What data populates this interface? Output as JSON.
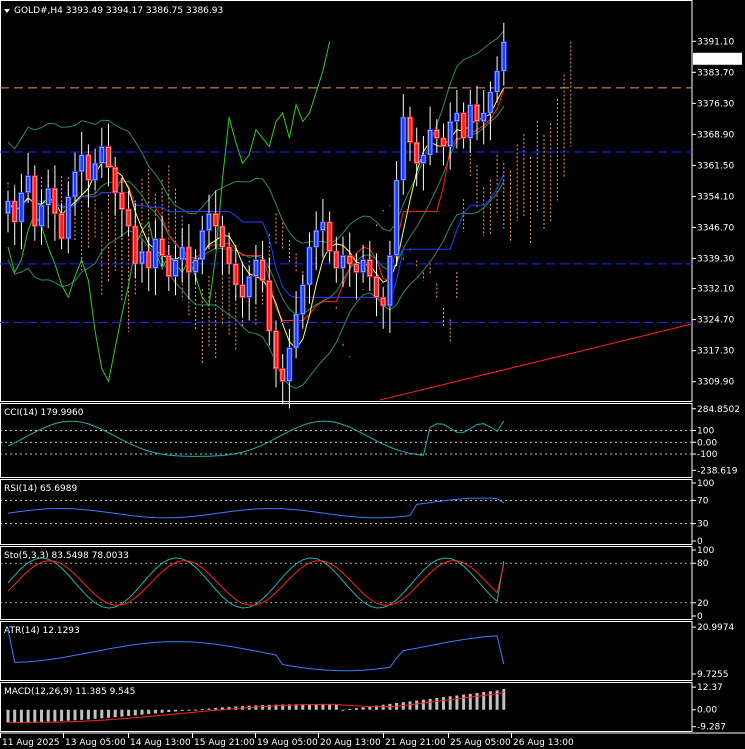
{
  "header": {
    "symbol_label": "GOLD#,H4",
    "ohlc_label": "3393.49 3394.17 3386.75 3386.93"
  },
  "colors": {
    "bg": "#000000",
    "up": "#1f3fff",
    "down": "#ff2020",
    "text": "#ffffff",
    "grid": "#ffffff",
    "panel_border": "#ffffff",
    "kumo": "#ff9966",
    "ichimoku_tenkan": "#ff2020",
    "ichimoku_kijun": "#1f3fff",
    "chikou": "#2ecc2e",
    "bollinger": "#2e8b57",
    "ma": "#ffff66",
    "hline_blue": "#2424ff",
    "hline_orange": "#d2a26b",
    "trend": "#ff2020",
    "cci": "#20b2aa",
    "rsi": "#3a7bff",
    "stoch_main": "#20b2aa",
    "stoch_signal": "#ff2020",
    "atr": "#3a7bff",
    "macd_signal": "#ff2020",
    "macd_hist": "#c0c0c0"
  },
  "chart_data": [
    {
      "type": "candlestick",
      "title": "GOLD#,H4",
      "ylim": [
        3306,
        3400
      ],
      "yticks": [
        "3391.10",
        "3383.70",
        "3376.30",
        "3368.90",
        "3361.50",
        "3354.10",
        "3346.70",
        "3339.30",
        "3332.10",
        "3324.70",
        "3317.30",
        "3309.90"
      ],
      "last_price_label": "3386.93",
      "x_tick_labels": [
        "11 Aug 2025",
        "13 Aug 05:00",
        "14 Aug 13:00",
        "15 Aug 21:00",
        "19 Aug 05:00",
        "20 Aug 13:00",
        "21 Aug 21:00",
        "25 Aug 05:00",
        "26 Aug 13:00"
      ],
      "horizontal_lines": [
        {
          "value": 3380.0,
          "style": "dashed",
          "color": "orange"
        },
        {
          "value": 3364.7,
          "style": "dashed",
          "color": "blue"
        },
        {
          "value": 3338.0,
          "style": "dashed",
          "color": "blue"
        },
        {
          "value": 3324.0,
          "style": "dashed",
          "color": "blue"
        }
      ],
      "close": [
        3353,
        3348,
        3355,
        3359,
        3347,
        3352,
        3356,
        3350,
        3344,
        3354,
        3360,
        3364,
        3358,
        3362,
        3366,
        3361,
        3355,
        3351,
        3347,
        3338,
        3341,
        3337,
        3344,
        3340,
        3335,
        3339,
        3342,
        3336,
        3339,
        3346,
        3350,
        3347,
        3342,
        3338,
        3333,
        3330,
        3335,
        3339,
        3334,
        3322,
        3313,
        3310,
        3318,
        3326,
        3333,
        3342,
        3346,
        3348,
        3341,
        3337,
        3340,
        3338,
        3336,
        3339,
        3335,
        3330,
        3328,
        3340,
        3358,
        3373,
        3367,
        3362,
        3364,
        3370,
        3368,
        3366,
        3372,
        3374,
        3368,
        3376,
        3372,
        3374,
        3379,
        3384,
        3391
      ]
    },
    {
      "type": "line",
      "title": "CCI(14) 179.9960",
      "ylim": [
        -270,
        300
      ],
      "yticks": [
        "284.8502",
        "100",
        "0.00",
        "-100",
        "-238.619"
      ],
      "levels": [
        100,
        0,
        -100
      ]
    },
    {
      "type": "line",
      "title": "RSI(14) 65.6989",
      "ylim": [
        0,
        100
      ],
      "yticks": [
        "100",
        "70",
        "30",
        "0"
      ],
      "levels": [
        70,
        30
      ]
    },
    {
      "type": "line",
      "title": "Sto(5,3,3) 83.5498 78.0033",
      "ylim": [
        0,
        100
      ],
      "yticks": [
        "100",
        "80",
        "20",
        "0"
      ],
      "levels": [
        80,
        20
      ]
    },
    {
      "type": "line",
      "title": "ATR(14) 12.1293",
      "ylim": [
        9,
        21.5
      ],
      "yticks": [
        "20.9974",
        "9.7255"
      ],
      "levels": []
    },
    {
      "type": "bar",
      "title": "MACD(12,26,9) 11.385 9.545",
      "ylim": [
        -10,
        13
      ],
      "yticks": [
        "12.37",
        "0.00",
        "-9.287"
      ],
      "levels": []
    }
  ]
}
